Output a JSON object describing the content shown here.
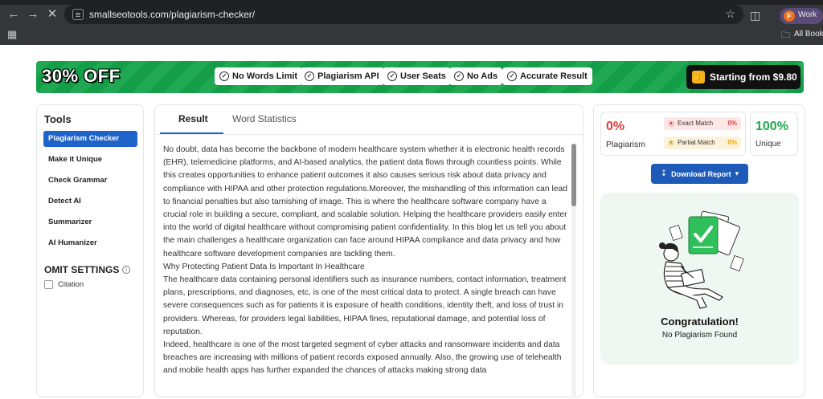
{
  "browser": {
    "url": "smallseotools.com/plagiarism-checker/",
    "profile_label": "Work",
    "profile_initial": "F",
    "bookmarks_label": "All Bookm"
  },
  "promo": {
    "offer": "30% OFF",
    "features": [
      "No Words Limit",
      "Plagiarism API",
      "User Seats",
      "No Ads",
      "Accurate Result"
    ],
    "cta": "Starting from $9.80"
  },
  "sidebar": {
    "title": "Tools",
    "items": [
      "Plagiarism Checker",
      "Make it Unique",
      "Check Grammar",
      "Detect AI",
      "Summarizer",
      "AI Humanizer"
    ],
    "omit_title": "OMIT SETTINGS",
    "citation_label": "Citation"
  },
  "result": {
    "tabs": [
      "Result",
      "Word Statistics"
    ],
    "paragraphs": [
      "No doubt, data has become the backbone of modern healthcare system whether it is electronic health records (EHR), telemedicine platforms, and AI-based analytics, the patient data flows through countless points. While this creates opportunities to enhance patient outcomes it also causes serious risk about data privacy and compliance with HIPAA and other protection regulations.Moreover, the mishandling of this information can lead to financial penalties but also tarnishing of image. This is where the healthcare software company have a crucial role in building a secure, compliant, and scalable solution. Helping the healthcare providers easily enter into the world of digital healthcare without compromising patient confidentiality. In this blog let us tell you about the main challenges a healthcare organization can face around HIPAA compliance and data privacy and how healthcare software development companies are tackling them.",
      "Why Protecting Patient Data Is Important In Healthcare",
      "The healthcare data containing personal identifiers such as insurance numbers, contact information, treatment plans, prescriptions, and diagnoses, etc, is one of the most critical data to protect. A single breach can have severe consequences such as for patients it is exposure of health conditions, identity theft, and loss of trust in providers. Whereas, for providers legal liabilities, HIPAA fines, reputational damage, and potential loss of reputation.",
      "Indeed, healthcare is one of the most targeted segment of cyber attacks and ransomware incidents and data breaches are increasing with millions of patient records exposed annually. Also, the growing use of telehealth and mobile health apps has further expanded the chances of attacks making strong data"
    ]
  },
  "stats": {
    "plagiarism_pct": "0%",
    "plagiarism_label": "Plagiarism",
    "exact_label": "Exact Match",
    "exact_value": "0%",
    "partial_label": "Partial Match",
    "partial_value": "0%",
    "unique_pct": "100%",
    "unique_label": "Unique",
    "download_label": "Download Report",
    "congrats_title": "Congratulation!",
    "congrats_sub": "No Plagiarism Found"
  },
  "colors": {
    "accent_blue": "#1e63c9",
    "promo_green": "#14a34a",
    "plagiarism_red": "#e43b3b",
    "unique_green": "#1fa84b"
  }
}
